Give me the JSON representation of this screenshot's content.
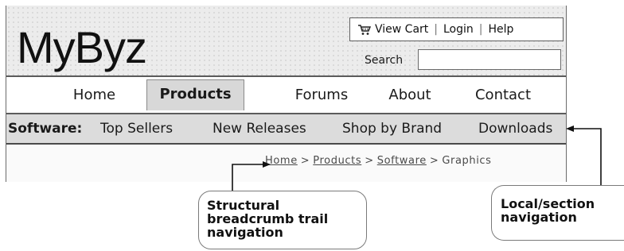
{
  "site": {
    "logo": "MyByz",
    "utility": {
      "cart_label": "View Cart",
      "login_label": "Login",
      "help_label": "Help",
      "separator": "|"
    },
    "search": {
      "label": "Search",
      "value": "",
      "placeholder": ""
    }
  },
  "main_nav": {
    "tabs": [
      {
        "label": "Home",
        "active": false
      },
      {
        "label": "Products",
        "active": true
      },
      {
        "label": "Forums",
        "active": false
      },
      {
        "label": "About",
        "active": false
      },
      {
        "label": "Contact",
        "active": false
      }
    ]
  },
  "sub_nav": {
    "section_label": "Software:",
    "links": [
      "Top Sellers",
      "New Releases",
      "Shop by Brand",
      "Downloads"
    ]
  },
  "breadcrumb": {
    "links": [
      "Home",
      "Products",
      "Software"
    ],
    "separator": ">",
    "current": "Graphics"
  },
  "annotations": {
    "breadcrumb_callout": [
      "Structural",
      "breadcrumb trail",
      "navigation"
    ],
    "local_callout": [
      "Local/section",
      "navigation"
    ]
  },
  "colors": {
    "frame": "#5b5b5b",
    "subnav_bg": "#dcdcdc",
    "active_tab_bg": "#d8d8d8"
  },
  "icons": {
    "cart": "shopping-cart-icon"
  }
}
